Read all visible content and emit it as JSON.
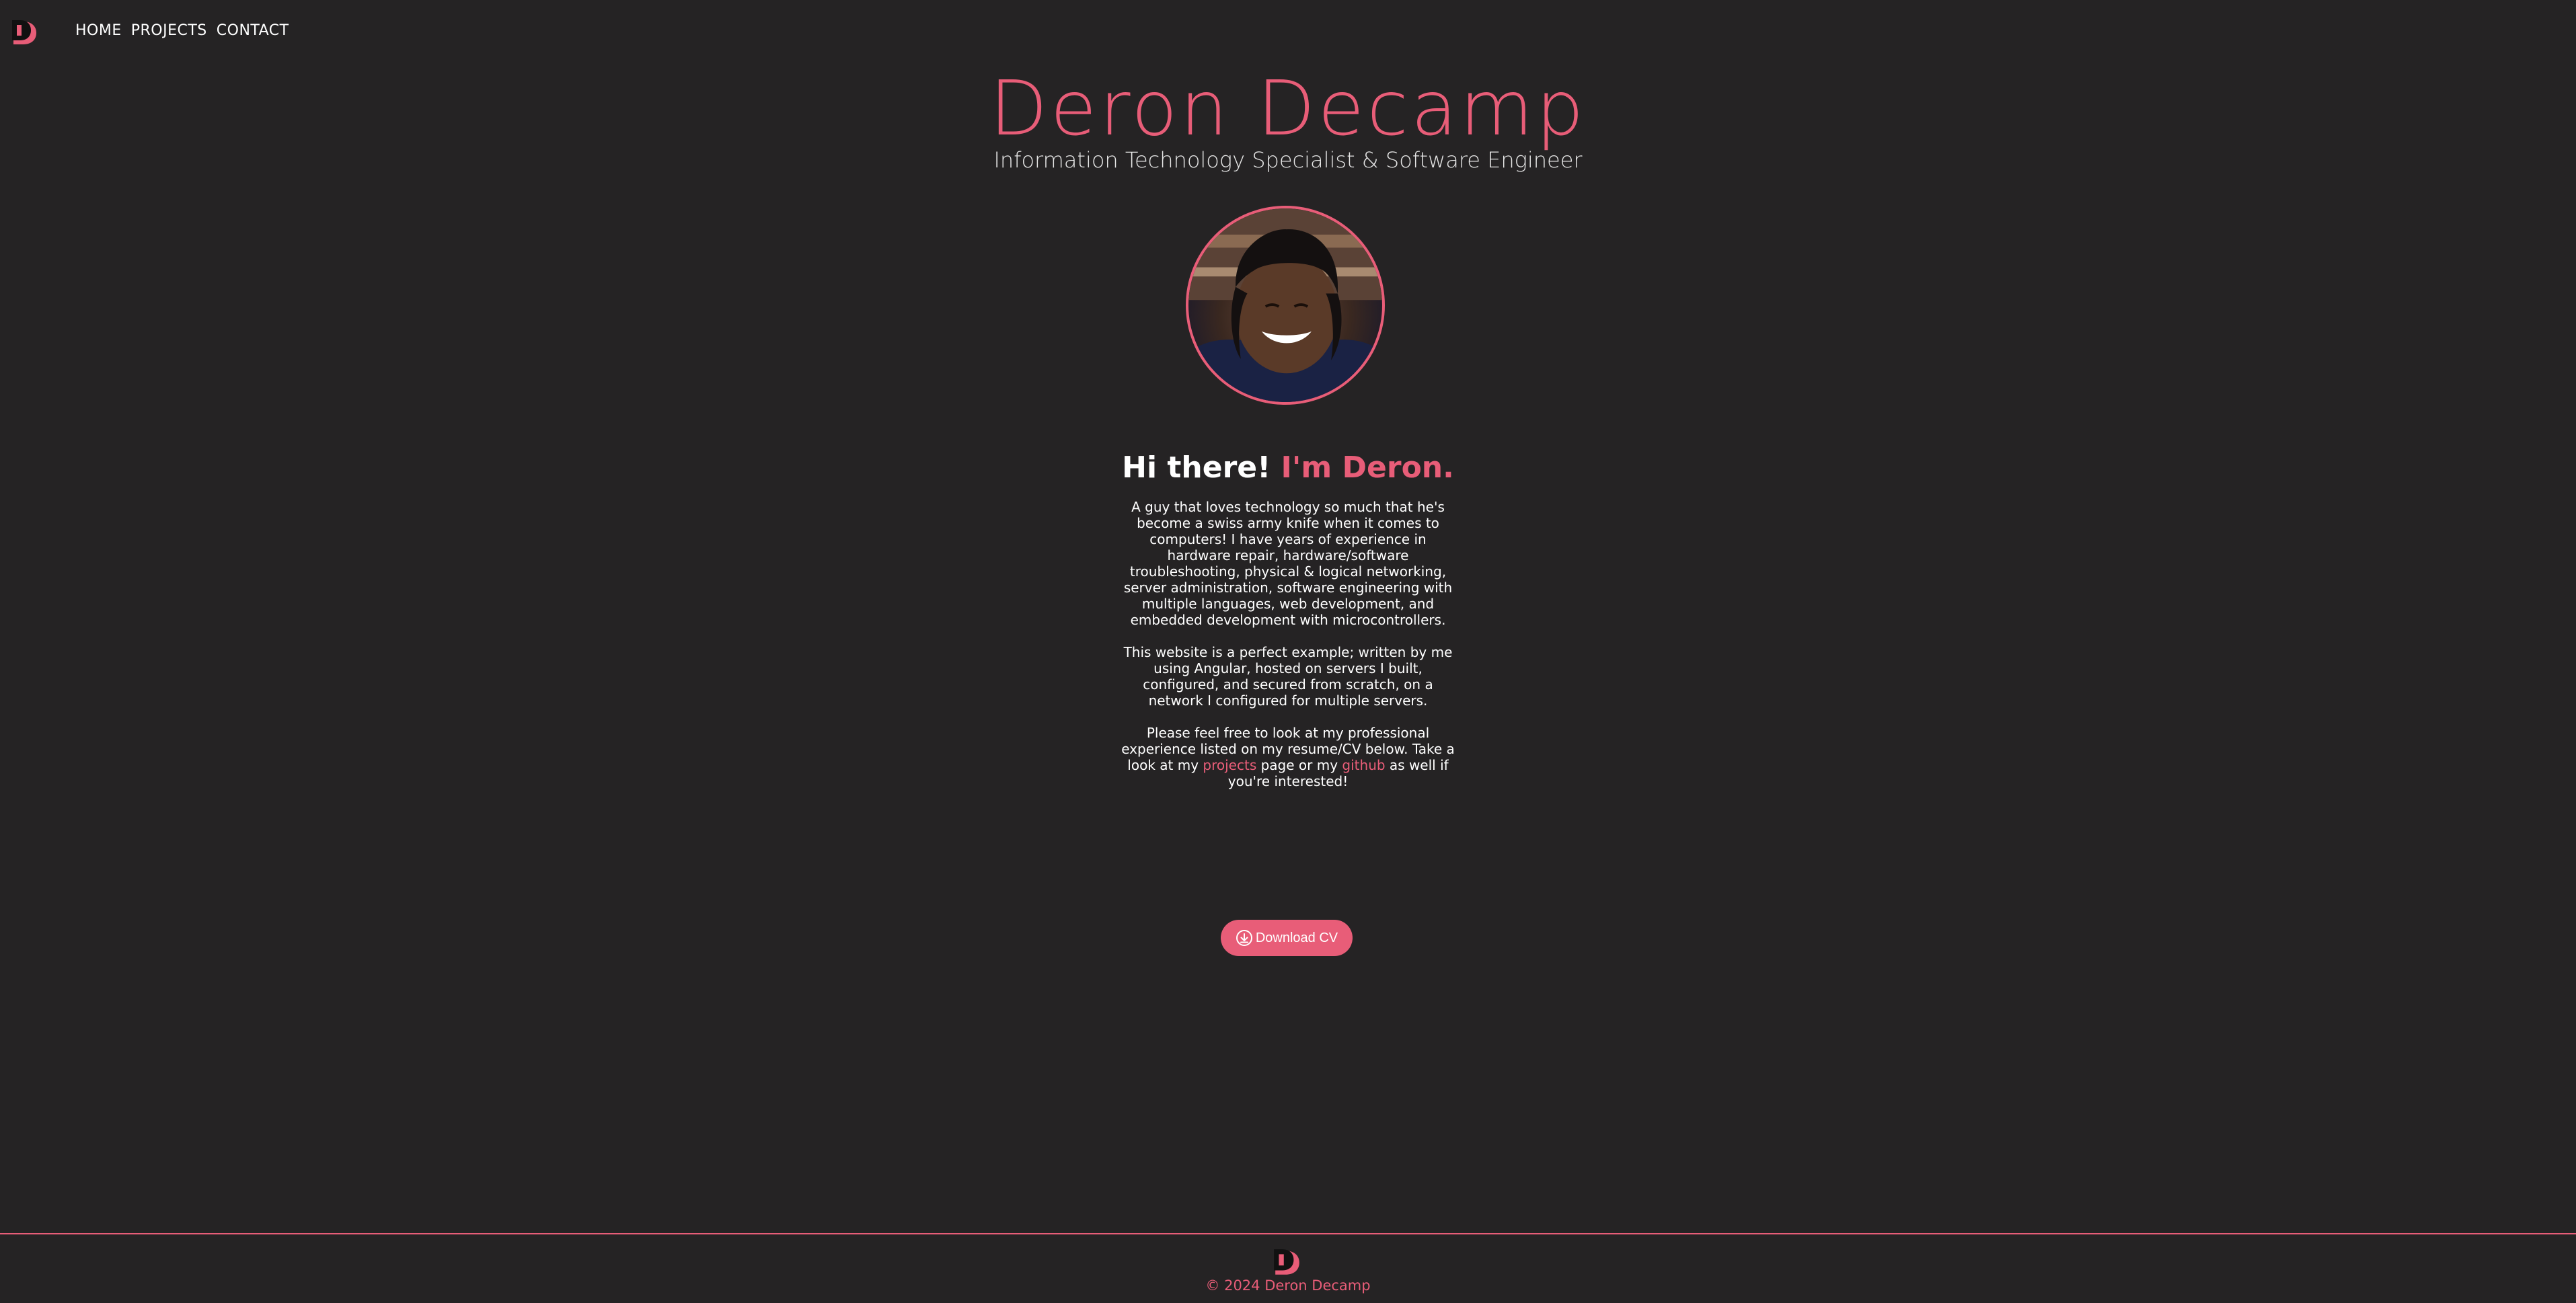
{
  "brand": {
    "logo_icon": "dd-monogram-icon",
    "accent_color": "#e85d78",
    "background": "#252324"
  },
  "nav": {
    "items": [
      {
        "label": "HOME"
      },
      {
        "label": "PROJECTS"
      },
      {
        "label": "CONTACT"
      }
    ]
  },
  "hero": {
    "title": "Deron Decamp",
    "subtitle": "Information Technology Specialist & Software Engineer"
  },
  "avatar": {
    "icon": "profile-photo"
  },
  "about": {
    "greeting_prefix": "Hi there!",
    "greeting_name": "I'm Deron.",
    "paragraph1": "A guy that loves technology so much that he's become a swiss army knife when it comes to computers! I have years of experience in hardware repair, hardware/software troubleshooting, physical & logical networking, server administration, software engineering with multiple languages, web development, and embedded development with microcontrollers.",
    "paragraph2": "This website is a perfect example; written by me using Angular, hosted on servers I built, configured, and secured from scratch, on a network I configured for multiple servers.",
    "paragraph3_start": "Please feel free to look at my professional experience listed on my resume/CV below. Take a look at my ",
    "projects_link": "projects",
    "paragraph3_mid": " page or my ",
    "github_link": "github",
    "paragraph3_end": " as well if you're interested!"
  },
  "cv": {
    "label": "Download CV",
    "icon": "download-circle-icon"
  },
  "footer": {
    "copyright": "© 2024 Deron Decamp"
  }
}
